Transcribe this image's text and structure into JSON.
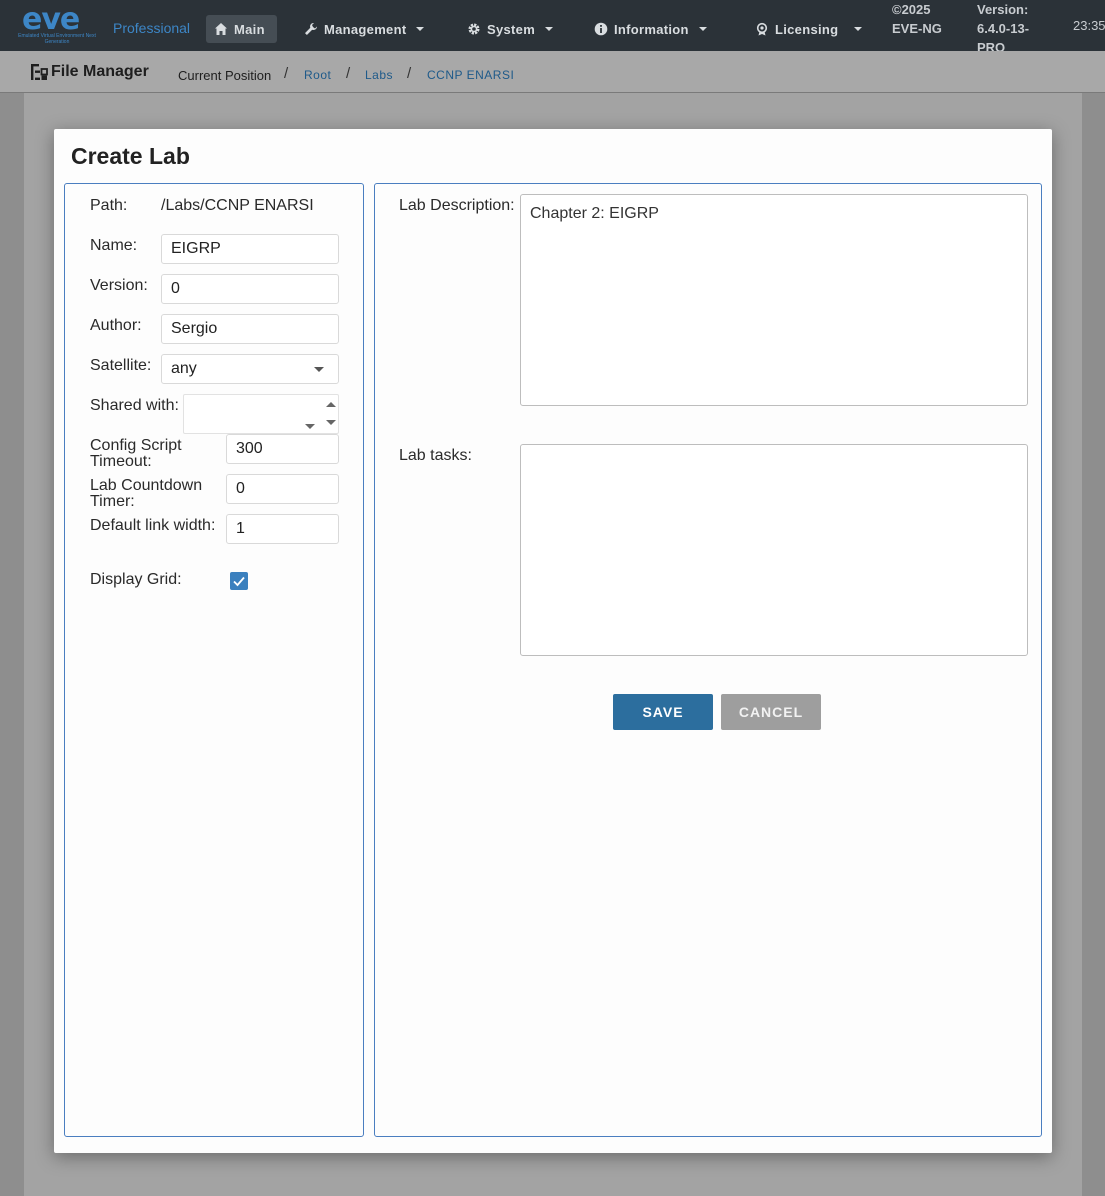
{
  "brand": {
    "logo_text": "eve",
    "logo_tagline": "Emulated Virtual Environment Next Generation",
    "edition": "Professional"
  },
  "nav": {
    "items": [
      {
        "label": "Main",
        "icon": "home-icon"
      },
      {
        "label": "Management",
        "icon": "wrench-icon"
      },
      {
        "label": "System",
        "icon": "gear-icon"
      },
      {
        "label": "Information",
        "icon": "info-icon"
      },
      {
        "label": "Licensing",
        "icon": "license-icon"
      }
    ],
    "copyright": "©2025 EVE-NG",
    "version": "Version: 6.4.0-13-PRO",
    "clock": "23:35"
  },
  "breadcrumb": {
    "section_title": "File Manager",
    "current_label": "Current Position",
    "crumbs": [
      "Root",
      "Labs",
      "CCNP ENARSI"
    ]
  },
  "modal": {
    "title": "Create Lab",
    "path_label": "Path:",
    "path_value": "/Labs/CCNP ENARSI",
    "name_label": "Name:",
    "name_value": "EIGRP",
    "version_label": "Version:",
    "version_value": "0",
    "author_label": "Author:",
    "author_value": "Sergio",
    "satellite_label": "Satellite:",
    "satellite_value": "any",
    "shared_label": "Shared with:",
    "config_label_1": "Config Script",
    "config_label_2": "Timeout:",
    "config_value": "300",
    "countdown_label_1": "Lab Countdown",
    "countdown_label_2": "Timer:",
    "countdown_value": "0",
    "linkwidth_label": "Default link width:",
    "linkwidth_value": "1",
    "grid_label": "Display Grid:",
    "grid_checked": true,
    "description_label": "Lab Description:",
    "description_value": "Chapter 2: EIGRP",
    "tasks_label": "Lab tasks:",
    "tasks_value": "",
    "save_label": "SAVE",
    "cancel_label": "CANCEL"
  },
  "colors": {
    "navbar": "#2b3238",
    "accent": "#3d86c6",
    "save": "#2c6e9e",
    "cancel": "#9e9e9e",
    "border": "#4a7ec0"
  }
}
